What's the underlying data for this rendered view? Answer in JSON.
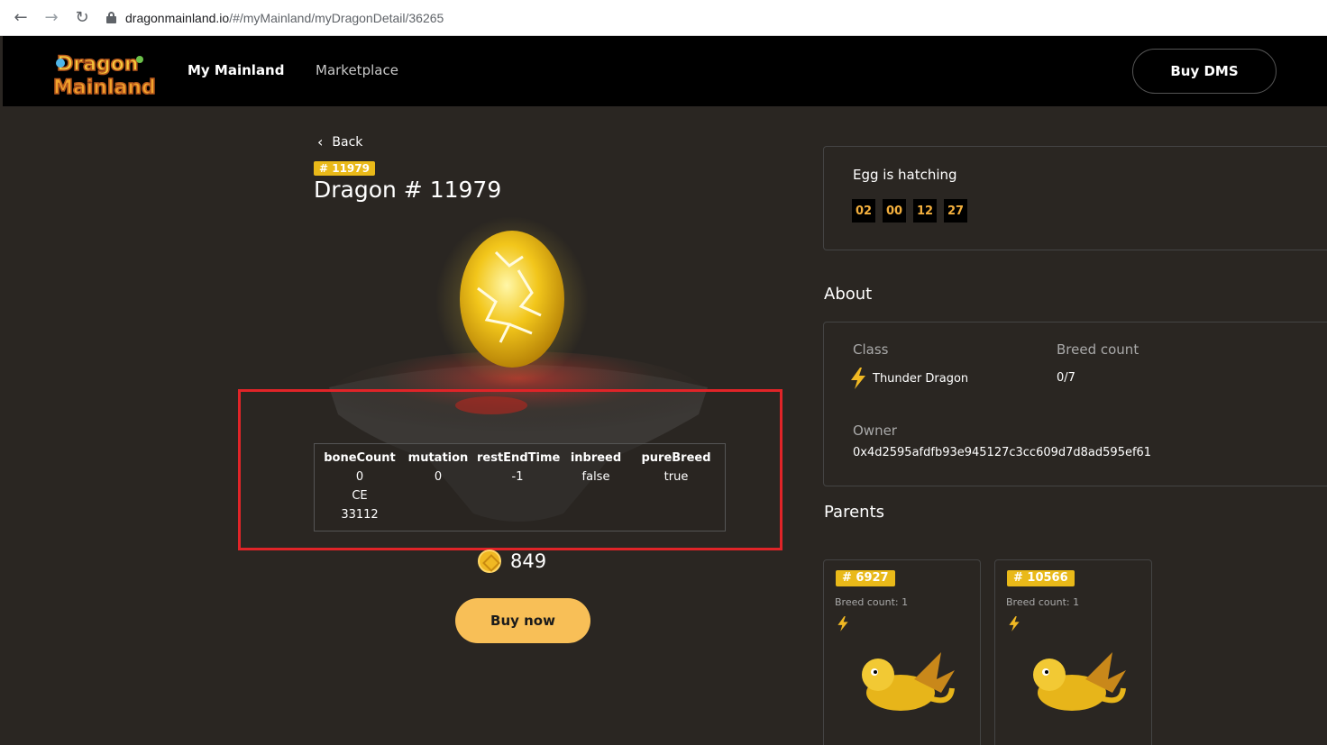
{
  "browser": {
    "domain": "dragonmainland.io",
    "path": "/#/myMainland/myDragonDetail/36265"
  },
  "header": {
    "logo_text": "Dragon Mainland",
    "nav": {
      "my_mainland": "My Mainland",
      "marketplace": "Marketplace"
    },
    "buy_dms": "Buy DMS"
  },
  "dragon": {
    "back_label": "Back",
    "id_badge": "# 11979",
    "title": "Dragon # 11979",
    "stats": {
      "boneCount": {
        "label": "boneCount",
        "value": "0"
      },
      "mutation": {
        "label": "mutation",
        "value": "0"
      },
      "restEndTime": {
        "label": "restEndTime",
        "value": "-1"
      },
      "inbreed": {
        "label": "inbreed",
        "value": "false"
      },
      "pureBreed": {
        "label": "pureBreed",
        "value": "true"
      },
      "CE": {
        "label": "CE",
        "value": "33112"
      }
    },
    "price": "849",
    "buy_now": "Buy now"
  },
  "hatch": {
    "title": "Egg is hatching",
    "timer": [
      "02",
      "00",
      "12",
      "27"
    ]
  },
  "about": {
    "title": "About",
    "class_label": "Class",
    "class_value": "Thunder Dragon",
    "breed_label": "Breed count",
    "breed_value": "0/7",
    "owner_label": "Owner",
    "owner_value": "0x4d2595afdfb93e945127c3cc609d7d8ad595ef61"
  },
  "parents": {
    "title": "Parents",
    "items": [
      {
        "id": "# 6927",
        "breed": "Breed count: 1"
      },
      {
        "id": "# 10566",
        "breed": "Breed count: 1"
      }
    ]
  },
  "colors": {
    "accent": "#e9b919",
    "button": "#f8bf57",
    "highlight": "#e02428",
    "timer_text": "#f4b03e"
  },
  "icons": [
    "back-arrow-icon",
    "forward-arrow-icon",
    "reload-icon",
    "lock-icon",
    "chevron-left-icon",
    "coin-icon",
    "thunder-bolt-icon"
  ]
}
